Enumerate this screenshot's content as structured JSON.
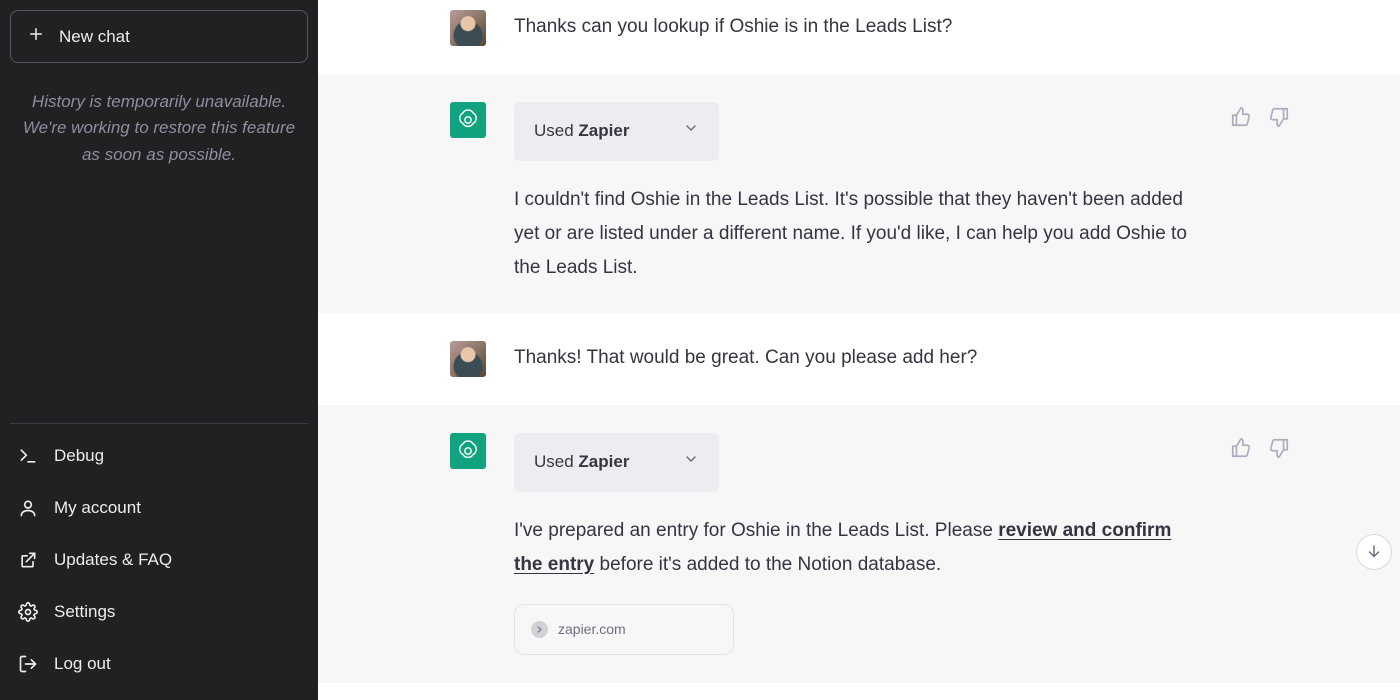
{
  "sidebar": {
    "new_chat_label": "New chat",
    "history_status": "History is temporarily unavailable. We're working to restore this feature as soon as possible.",
    "links": {
      "debug": "Debug",
      "account": "My account",
      "updates": "Updates & FAQ",
      "settings": "Settings",
      "logout": "Log out"
    }
  },
  "messages": {
    "m0": {
      "role": "user",
      "text": "Thanks can you lookup if Oshie is in the Leads List?"
    },
    "m1": {
      "role": "assistant",
      "tool_prefix": "Used ",
      "tool_name": "Zapier",
      "text": "I couldn't find Oshie in the Leads List. It's possible that they haven't been added yet or are listed under a different name. If you'd like, I can help you add Oshie to the Leads List."
    },
    "m2": {
      "role": "user",
      "text": "Thanks! That would be great. Can you please add her?"
    },
    "m3": {
      "role": "assistant",
      "tool_prefix": "Used ",
      "tool_name": "Zapier",
      "text_before_link": "I've prepared an entry for Oshie in the Leads List. Please ",
      "link_text": "review and confirm the entry",
      "text_after_link": " before it's added to the Notion database.",
      "link_card_domain": "zapier.com"
    }
  }
}
